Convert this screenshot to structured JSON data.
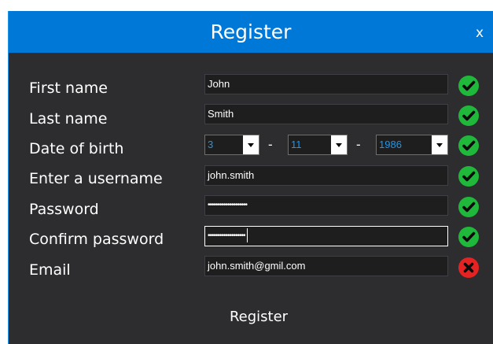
{
  "window": {
    "title": "Register",
    "close_label": "x"
  },
  "form": {
    "first_name": {
      "label": "First name",
      "value": "John",
      "valid": true
    },
    "last_name": {
      "label": "Last name",
      "value": "Smith",
      "valid": true
    },
    "date_of_birth": {
      "label": "Date of birth",
      "day": "3",
      "month": "11",
      "year": "1986",
      "separator": "-",
      "valid": true
    },
    "username": {
      "label": "Enter a username",
      "value": "john.smith",
      "valid": true
    },
    "password": {
      "label": "Password",
      "value": "••••••••••••••••••••",
      "valid": true
    },
    "confirm_password": {
      "label": "Confirm password",
      "value": "•••••••••••••••••••",
      "valid": true
    },
    "email": {
      "label": "Email",
      "value": "john.smith@gmil.com",
      "valid": false
    }
  },
  "register_label": "Register",
  "icons": {
    "valid": "check-circle-icon",
    "invalid": "x-circle-icon"
  },
  "colors": {
    "titlebar": "#0078d7",
    "window_bg": "#2d2d30",
    "input_bg": "#1e1e1e",
    "valid": "#1fb83a",
    "invalid": "#e52323",
    "combo_text": "#1c97ea"
  }
}
